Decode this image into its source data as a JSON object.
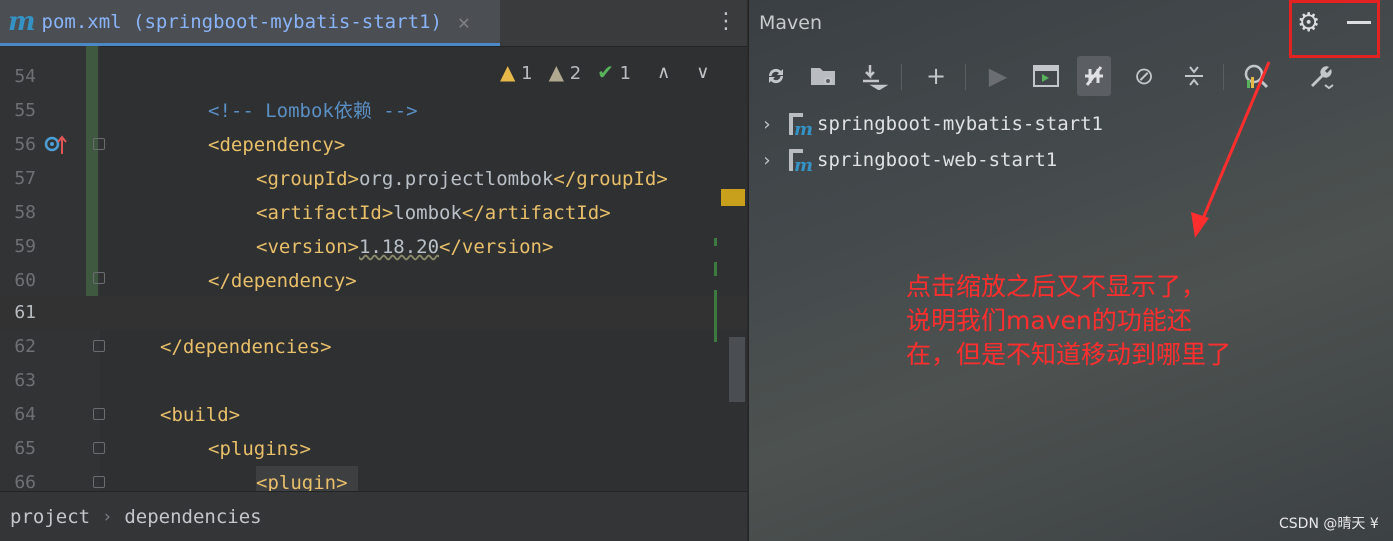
{
  "editor": {
    "tab": {
      "icon": "m",
      "title": "pom.xml (springboot-mybatis-start1)",
      "close": "✕"
    },
    "more_menu": "⋮",
    "inspections": {
      "warnings": "1",
      "weak_warnings": "2",
      "ok": "1",
      "up": "∧",
      "down": "∨"
    },
    "lines": [
      {
        "num": "54",
        "text": ""
      },
      {
        "num": "55",
        "text": "<!-- Lombok依赖 -->",
        "kind": "comment"
      },
      {
        "num": "56",
        "text": "<dependency>",
        "kind": "tag"
      },
      {
        "num": "57",
        "open": "<groupId>",
        "value": "org.projectlombok",
        "close": "</groupId>"
      },
      {
        "num": "58",
        "open": "<artifactId>",
        "value": "lombok",
        "close": "</artifactId>"
      },
      {
        "num": "59",
        "open": "<version>",
        "value": "1.18.20",
        "close": "</version>"
      },
      {
        "num": "60",
        "text": "</dependency>",
        "kind": "tag"
      },
      {
        "num": "61",
        "text": ""
      },
      {
        "num": "62",
        "text": "</dependencies>",
        "kind": "tag"
      },
      {
        "num": "63",
        "text": ""
      },
      {
        "num": "64",
        "text": "<build>",
        "kind": "tag"
      },
      {
        "num": "65",
        "text": "<plugins>",
        "kind": "tag"
      },
      {
        "num": "66",
        "text": "<plugin>",
        "kind": "tag"
      }
    ],
    "breadcrumb": [
      "project",
      "dependencies"
    ],
    "breadcrumb_sep": "›"
  },
  "maven": {
    "title": "Maven",
    "toolbar": [
      "reload-icon",
      "add-folder-icon",
      "download-icon",
      "plus-icon",
      "run-icon",
      "execute-goal-icon",
      "toggle-offline-icon",
      "skip-tests-icon",
      "collapse-icon",
      "analyze-icon",
      "settings-wrench-icon"
    ],
    "projects": [
      "springboot-mybatis-start1",
      "springboot-web-start1"
    ],
    "annotation": "点击缩放之后又不显示了，说明我们maven的功能还在，但是不知道移动到哪里了",
    "annotation_lines": [
      "点击缩放之后又不显示了，",
      "说明我们maven的功能还",
      "在，但是不知道移动到哪里了"
    ],
    "highlight_color": "#e52222"
  },
  "watermark": "CSDN @晴天 ¥"
}
